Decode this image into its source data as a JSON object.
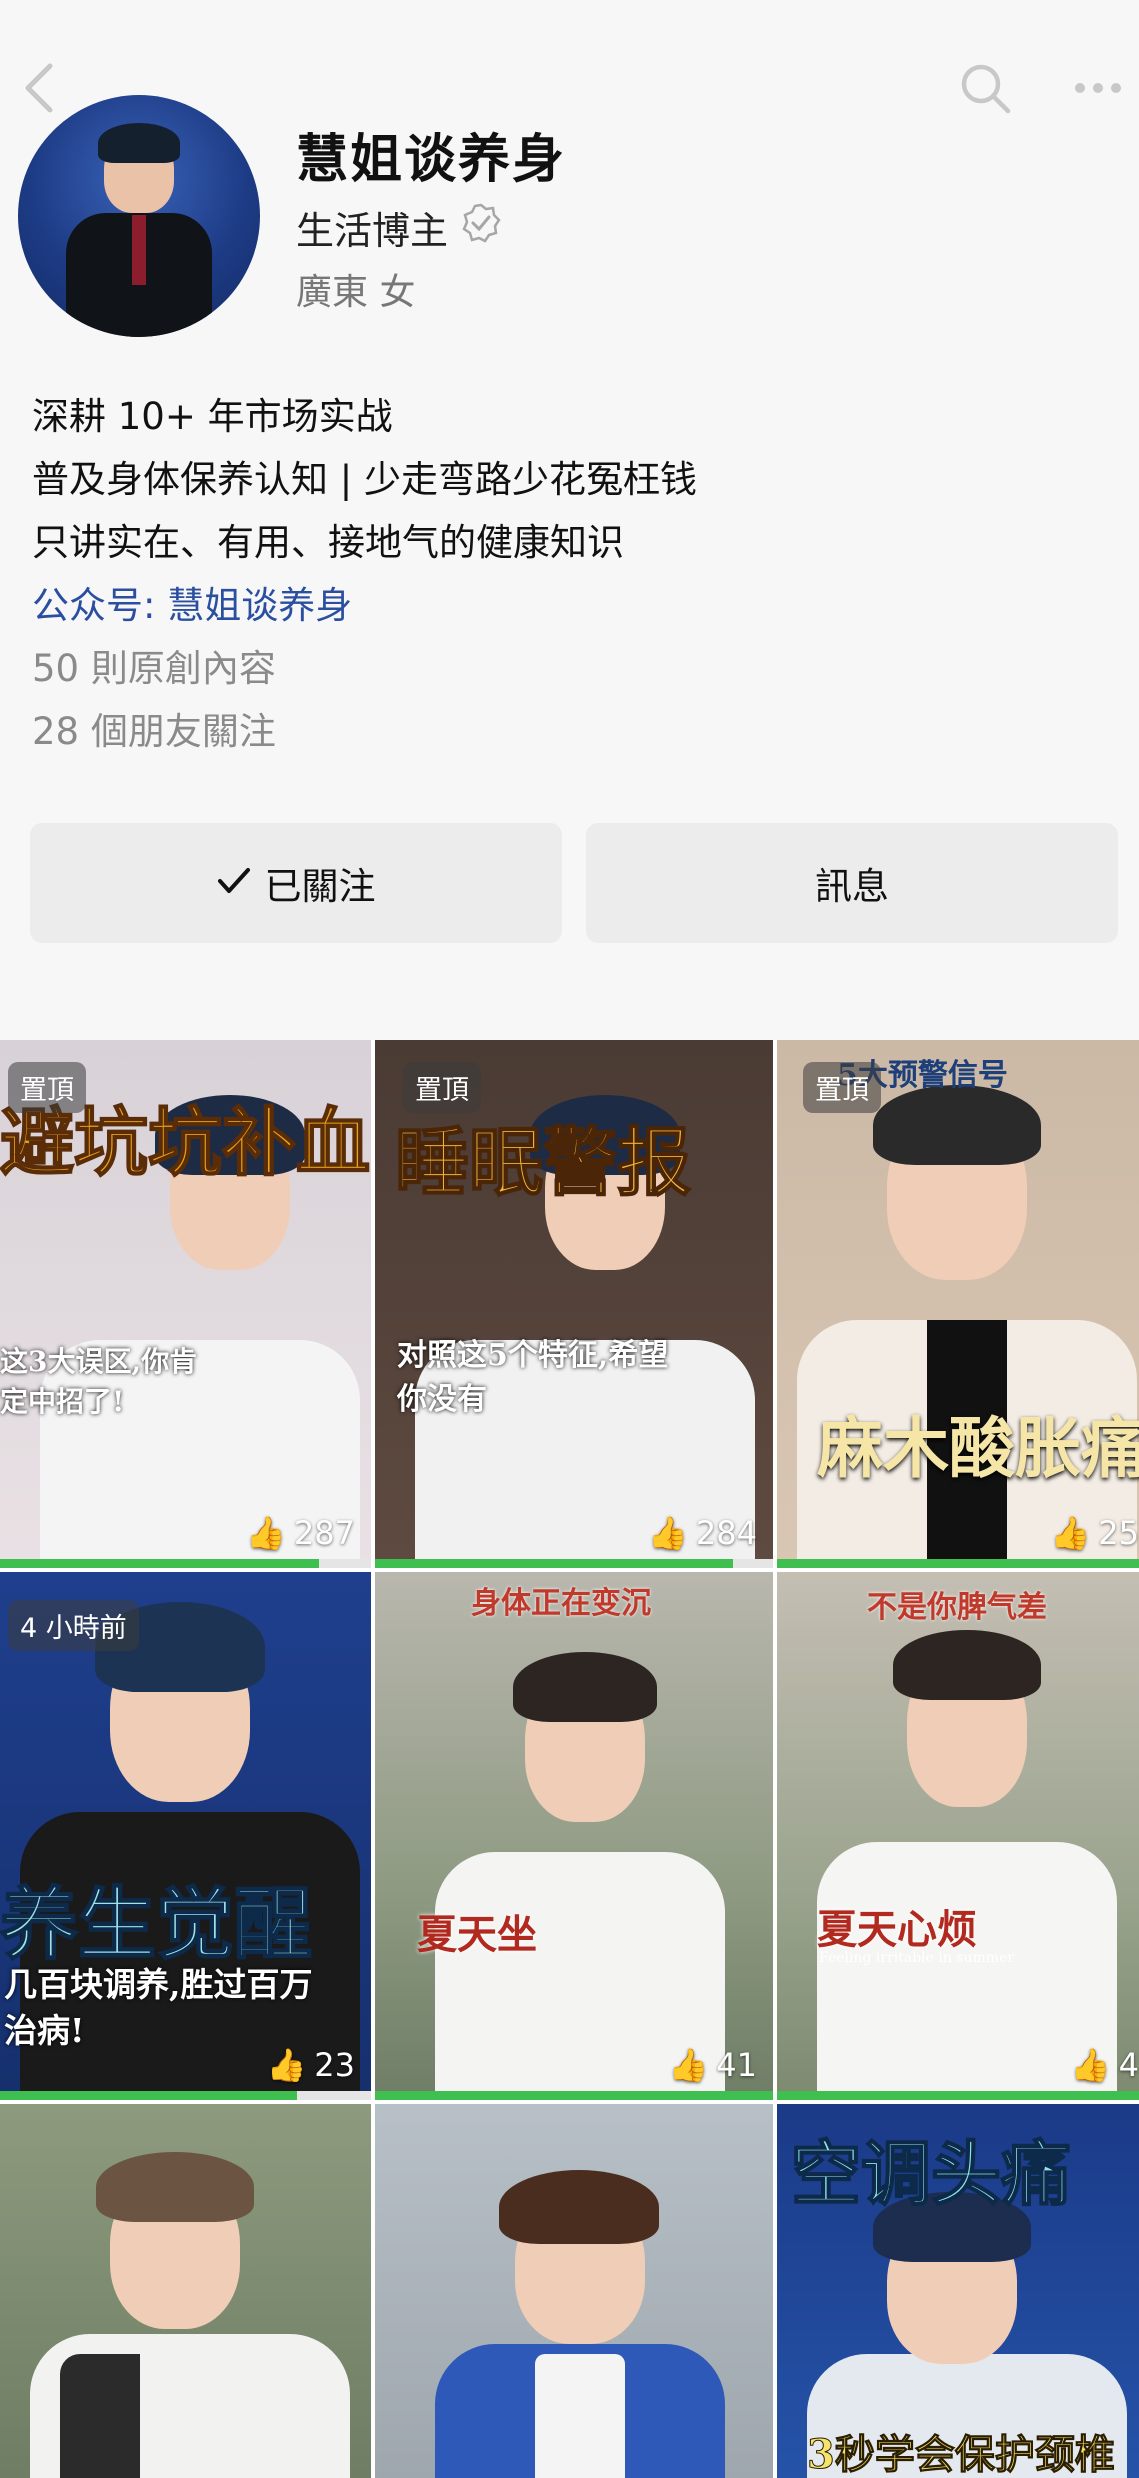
{
  "profile": {
    "name": "慧姐谈养身",
    "role": "生活博主",
    "location": "廣東 女"
  },
  "bio": {
    "line1": "深耕 10+ 年市场实战",
    "line2": "普及身体保养认知 | 少走弯路少花冤枉钱",
    "line3": "只讲实在、有用、接地气的健康知识",
    "official_prefix": "公众号: ",
    "official_name": "慧姐谈养身",
    "posts": "50 則原創內容",
    "friends": "28 個朋友關注"
  },
  "actions": {
    "follow_label": "已關注",
    "message_label": "訊息"
  },
  "videos": [
    {
      "badge": "置頂",
      "caption_big": "避坑坑补血",
      "caption_small": "这3大误区,你肯定中招了!",
      "likes": "287",
      "progress": 0.86
    },
    {
      "badge": "置頂",
      "caption_big": "睡眠警报",
      "caption_small": "对照这5个特征,希望你没有",
      "likes": "284",
      "progress": 0.9
    },
    {
      "badge": "置頂",
      "caption_top": "5大预警信号",
      "caption_big": "麻木酸胀痛痒",
      "likes": "25",
      "progress": 1.0
    },
    {
      "badge": "4 小時前",
      "caption_big": "养生觉醒",
      "caption_small": "几百块调养,胜过百万治病!",
      "likes": "23",
      "progress": 0.8
    },
    {
      "caption_top": "身体正在变沉",
      "caption_big": "夏天坐",
      "likes": "41",
      "progress": 1.0
    },
    {
      "caption_top": "不是你脾气差",
      "caption_big": "夏天心烦",
      "caption_small": "Feeling irritable in summer",
      "likes": "4",
      "progress": 1.0
    },
    {
      "likes": ""
    },
    {
      "likes": ""
    },
    {
      "caption_big": "空调头痛",
      "caption_small": "3秒学会保护颈椎",
      "likes": ""
    }
  ]
}
